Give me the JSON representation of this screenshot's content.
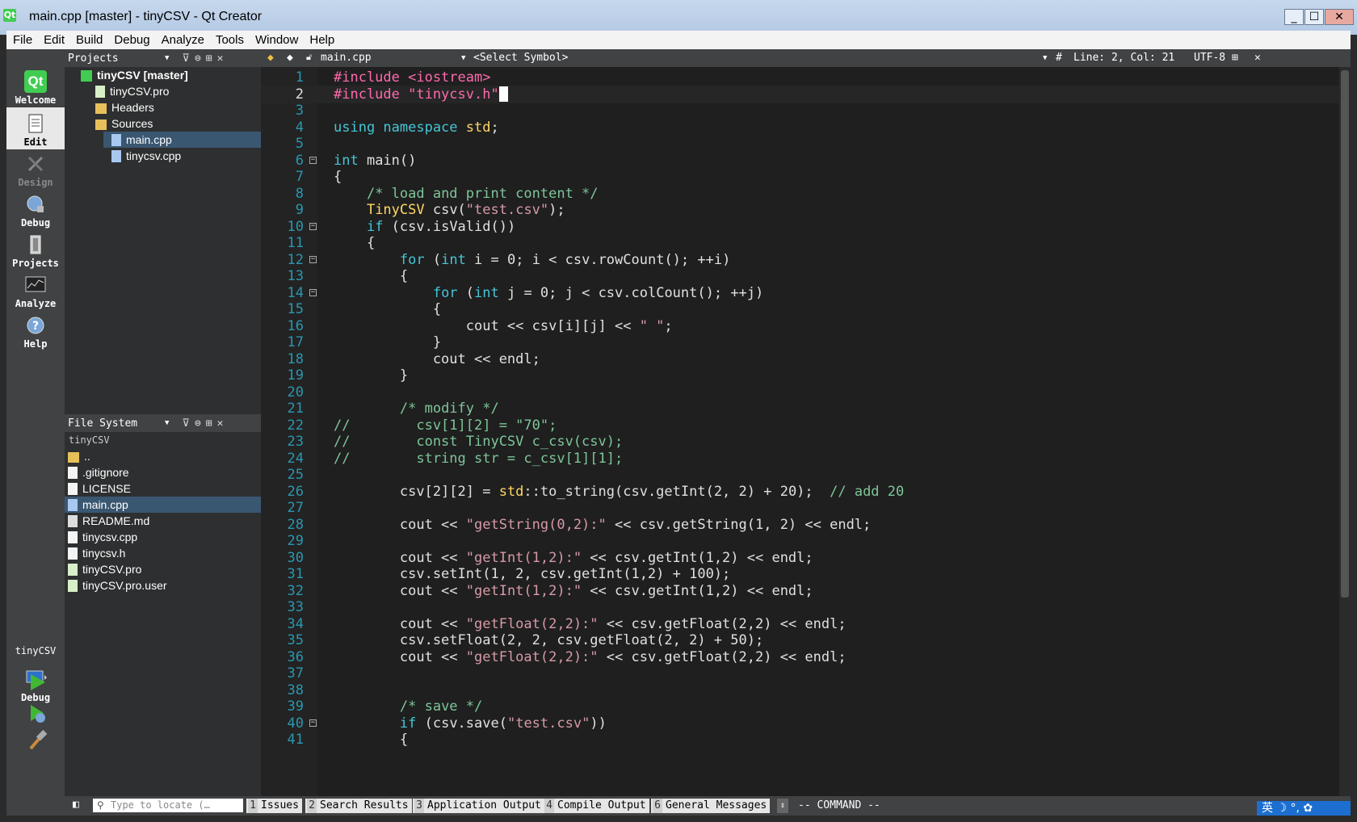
{
  "window": {
    "title": "main.cpp [master] - tinyCSV - Qt Creator",
    "app_icon_text": "Qt",
    "controls": [
      "_",
      "☐",
      "✕"
    ]
  },
  "menu": [
    "File",
    "Edit",
    "Build",
    "Debug",
    "Analyze",
    "Tools",
    "Window",
    "Help"
  ],
  "modes": [
    {
      "label": "Welcome",
      "state": "normal"
    },
    {
      "label": "Edit",
      "state": "active"
    },
    {
      "label": "Design",
      "state": "disabled"
    },
    {
      "label": "Debug",
      "state": "normal"
    },
    {
      "label": "Projects",
      "state": "normal"
    },
    {
      "label": "Analyze",
      "state": "normal"
    },
    {
      "label": "Help",
      "state": "normal"
    }
  ],
  "kit": {
    "project": "tinyCSV",
    "mode": "Debug"
  },
  "projects_pane": {
    "title": "Projects",
    "tree": [
      {
        "label": "tinyCSV [master]",
        "indent": 0,
        "icon": "qt-project-icon",
        "bold": true
      },
      {
        "label": "tinyCSV.pro",
        "indent": 1,
        "icon": "pro-file-icon"
      },
      {
        "label": "Headers",
        "indent": 1,
        "icon": "folder-icon"
      },
      {
        "label": "Sources",
        "indent": 1,
        "icon": "folder-icon"
      },
      {
        "label": "main.cpp",
        "indent": 2,
        "icon": "cpp-file-icon",
        "selected": true
      },
      {
        "label": "tinycsv.cpp",
        "indent": 2,
        "icon": "cpp-file-icon"
      }
    ]
  },
  "filesystem_pane": {
    "title": "File System",
    "root": "tinyCSV",
    "items": [
      {
        "label": "..",
        "icon": "folder-icon"
      },
      {
        "label": ".gitignore",
        "icon": "file-icon"
      },
      {
        "label": "LICENSE",
        "icon": "file-icon"
      },
      {
        "label": "main.cpp",
        "icon": "cpp-file-icon",
        "selected": true
      },
      {
        "label": "README.md",
        "icon": "md-file-icon"
      },
      {
        "label": "tinycsv.cpp",
        "icon": "file-icon"
      },
      {
        "label": "tinycsv.h",
        "icon": "file-icon"
      },
      {
        "label": "tinyCSV.pro",
        "icon": "pro-file-icon"
      },
      {
        "label": "tinyCSV.pro.user",
        "icon": "pro-file-icon"
      }
    ]
  },
  "editor_toolbar": {
    "file": "main.cpp",
    "symbol": "<Select Symbol>",
    "hash": "#",
    "position": "Line: 2, Col: 21",
    "encoding": "UTF-8"
  },
  "editor": {
    "current_line": 2,
    "lines": [
      {
        "n": "1",
        "parts": [
          [
            "pp",
            "#include <iostream>"
          ]
        ]
      },
      {
        "n": "2",
        "parts": [
          [
            "pp",
            "#include \"tinycsv.h\""
          ]
        ]
      },
      {
        "n": "3",
        "parts": []
      },
      {
        "n": "4",
        "parts": [
          [
            "kw",
            "using namespace "
          ],
          [
            "ty",
            "std"
          ],
          [
            "tx",
            ";"
          ]
        ]
      },
      {
        "n": "5",
        "parts": []
      },
      {
        "n": "6",
        "fold": true,
        "parts": [
          [
            "kw",
            "int"
          ],
          [
            "tx",
            " main()"
          ]
        ]
      },
      {
        "n": "7",
        "parts": [
          [
            "tx",
            "{"
          ]
        ]
      },
      {
        "n": "8",
        "parts": [
          [
            "tx",
            "    "
          ],
          [
            "cm",
            "/* load and print content */"
          ]
        ]
      },
      {
        "n": "9",
        "parts": [
          [
            "tx",
            "    "
          ],
          [
            "ty",
            "TinyCSV"
          ],
          [
            "tx",
            " csv("
          ],
          [
            "st",
            "\"test.csv\""
          ],
          [
            "tx",
            ");"
          ]
        ]
      },
      {
        "n": "10",
        "fold": true,
        "parts": [
          [
            "tx",
            "    "
          ],
          [
            "kw",
            "if"
          ],
          [
            "tx",
            " (csv.isValid())"
          ]
        ]
      },
      {
        "n": "11",
        "parts": [
          [
            "tx",
            "    {"
          ]
        ]
      },
      {
        "n": "12",
        "fold": true,
        "parts": [
          [
            "tx",
            "        "
          ],
          [
            "kw",
            "for"
          ],
          [
            "tx",
            " ("
          ],
          [
            "kw",
            "int"
          ],
          [
            "tx",
            " i = 0; i < csv.rowCount(); ++i)"
          ]
        ]
      },
      {
        "n": "13",
        "parts": [
          [
            "tx",
            "        {"
          ]
        ]
      },
      {
        "n": "14",
        "fold": true,
        "parts": [
          [
            "tx",
            "            "
          ],
          [
            "kw",
            "for"
          ],
          [
            "tx",
            " ("
          ],
          [
            "kw",
            "int"
          ],
          [
            "tx",
            " j = 0; j < csv.colCount(); ++j)"
          ]
        ]
      },
      {
        "n": "15",
        "parts": [
          [
            "tx",
            "            {"
          ]
        ]
      },
      {
        "n": "16",
        "parts": [
          [
            "tx",
            "                cout << csv[i][j] << "
          ],
          [
            "st",
            "\" \""
          ],
          [
            "tx",
            ";"
          ]
        ]
      },
      {
        "n": "17",
        "parts": [
          [
            "tx",
            "            }"
          ]
        ]
      },
      {
        "n": "18",
        "parts": [
          [
            "tx",
            "            cout << endl;"
          ]
        ]
      },
      {
        "n": "19",
        "parts": [
          [
            "tx",
            "        }"
          ]
        ]
      },
      {
        "n": "20",
        "parts": []
      },
      {
        "n": "21",
        "parts": [
          [
            "tx",
            "        "
          ],
          [
            "cm",
            "/* modify */"
          ]
        ]
      },
      {
        "n": "22",
        "parts": [
          [
            "cm",
            "//        csv[1][2] = \"70\";"
          ]
        ]
      },
      {
        "n": "23",
        "parts": [
          [
            "cm",
            "//        const TinyCSV c_csv(csv);"
          ]
        ]
      },
      {
        "n": "24",
        "parts": [
          [
            "cm",
            "//        string str = c_csv[1][1];"
          ]
        ]
      },
      {
        "n": "25",
        "parts": []
      },
      {
        "n": "26",
        "parts": [
          [
            "tx",
            "        csv[2][2] = "
          ],
          [
            "ty",
            "std"
          ],
          [
            "tx",
            "::to_string(csv.getInt(2, 2) + 20);  "
          ],
          [
            "cm",
            "// add 20"
          ]
        ]
      },
      {
        "n": "27",
        "parts": []
      },
      {
        "n": "28",
        "parts": [
          [
            "tx",
            "        cout << "
          ],
          [
            "st",
            "\"getString(0,2):\""
          ],
          [
            "tx",
            " << csv.getString(1, 2) << endl;"
          ]
        ]
      },
      {
        "n": "29",
        "parts": []
      },
      {
        "n": "30",
        "parts": [
          [
            "tx",
            "        cout << "
          ],
          [
            "st",
            "\"getInt(1,2):\""
          ],
          [
            "tx",
            " << csv.getInt(1,2) << endl;"
          ]
        ]
      },
      {
        "n": "31",
        "parts": [
          [
            "tx",
            "        csv.setInt(1, 2, csv.getInt(1,2) + 100);"
          ]
        ]
      },
      {
        "n": "32",
        "parts": [
          [
            "tx",
            "        cout << "
          ],
          [
            "st",
            "\"getInt(1,2):\""
          ],
          [
            "tx",
            " << csv.getInt(1,2) << endl;"
          ]
        ]
      },
      {
        "n": "33",
        "parts": []
      },
      {
        "n": "34",
        "parts": [
          [
            "tx",
            "        cout << "
          ],
          [
            "st",
            "\"getFloat(2,2):\""
          ],
          [
            "tx",
            " << csv.getFloat(2,2) << endl;"
          ]
        ]
      },
      {
        "n": "35",
        "parts": [
          [
            "tx",
            "        csv.setFloat(2, 2, csv.getFloat(2, 2) + 50);"
          ]
        ]
      },
      {
        "n": "36",
        "parts": [
          [
            "tx",
            "        cout << "
          ],
          [
            "st",
            "\"getFloat(2,2):\""
          ],
          [
            "tx",
            " << csv.getFloat(2,2) << endl;"
          ]
        ]
      },
      {
        "n": "37",
        "parts": []
      },
      {
        "n": "38",
        "parts": []
      },
      {
        "n": "39",
        "parts": [
          [
            "tx",
            "        "
          ],
          [
            "cm",
            "/* save */"
          ]
        ]
      },
      {
        "n": "40",
        "fold": true,
        "parts": [
          [
            "tx",
            "        "
          ],
          [
            "kw",
            "if"
          ],
          [
            "tx",
            " (csv.save("
          ],
          [
            "st",
            "\"test.csv\""
          ],
          [
            "tx",
            "))"
          ]
        ]
      },
      {
        "n": "41",
        "parts": [
          [
            "tx",
            "        {"
          ]
        ]
      }
    ]
  },
  "statusbar": {
    "locate_placeholder": "Type to locate (…",
    "tabs": [
      {
        "num": "1",
        "label": "Issues"
      },
      {
        "num": "2",
        "label": "Search Results"
      },
      {
        "num": "3",
        "label": "Application Output"
      },
      {
        "num": "4",
        "label": "Compile Output"
      },
      {
        "num": "6",
        "label": "General Messages"
      }
    ],
    "mode_text": "-- COMMAND --",
    "ime": "英 ☽ °, ✿"
  },
  "colors": {
    "accent": "#41cd52",
    "selection": "#3a5772",
    "editor_bg": "#1f1f1f",
    "line_number": "#2a97b0"
  }
}
